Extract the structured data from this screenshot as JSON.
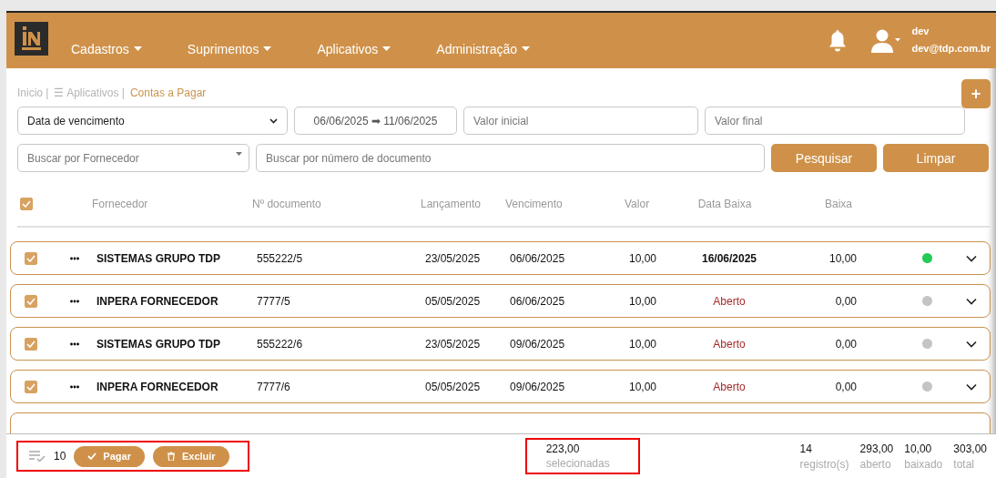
{
  "header": {
    "menus": [
      {
        "label": "Cadastros"
      },
      {
        "label": "Suprimentos"
      },
      {
        "label": "Aplicativos"
      },
      {
        "label": "Administração"
      }
    ],
    "user": {
      "name": "dev",
      "email": "dev@tdp.com.br"
    }
  },
  "breadcrumb": [
    {
      "label": "Inicio |",
      "current": false
    },
    {
      "label": "☰ Aplicativos |",
      "current": false
    },
    {
      "label": "Contas a Pagar",
      "current": true
    }
  ],
  "add_button": "+",
  "filters": {
    "date_type": "Data de vencimento",
    "date_range": "06/06/2025 ➡ 11/06/2025",
    "min_value": {
      "placeholder": "Valor inicial"
    },
    "max_value": {
      "placeholder": "Valor final"
    },
    "supplier": {
      "placeholder": "Buscar por Fornecedor"
    },
    "document": {
      "placeholder": "Buscar por número de documento"
    },
    "buttons": [
      "Pesquisar",
      "Limpar"
    ]
  },
  "table": {
    "all_checked": true,
    "columns": [
      "Fornecedor",
      "Nº documento",
      "Lançamento",
      "Vencimento",
      "Valor",
      "Data Baixa",
      "Baixa"
    ],
    "rows": [
      {
        "checked": true,
        "supplier": "SISTEMAS GRUPO TDP",
        "document": "555222/5",
        "issued": "23/05/2025",
        "due": "06/06/2025",
        "value": "10,00",
        "paid_date": "16/06/2025",
        "open": false,
        "paid": "10,00",
        "color": "#22cc55"
      },
      {
        "checked": true,
        "supplier": "INPERA FORNECEDOR",
        "document": "7777/5",
        "issued": "05/05/2025",
        "due": "06/06/2025",
        "value": "10,00",
        "paid_date": "Aberto",
        "open": true,
        "paid": "0,00",
        "color": "#c4c4c4"
      },
      {
        "checked": true,
        "supplier": "SISTEMAS GRUPO TDP",
        "document": "555222/6",
        "issued": "23/05/2025",
        "due": "09/06/2025",
        "value": "10,00",
        "paid_date": "Aberto",
        "open": true,
        "paid": "0,00",
        "color": "#c4c4c4"
      },
      {
        "checked": true,
        "supplier": "INPERA FORNECEDOR",
        "document": "7777/6",
        "issued": "05/05/2025",
        "due": "09/06/2025",
        "value": "10,00",
        "paid_date": "Aberto",
        "open": true,
        "paid": "0,00",
        "color": "#c4c4c4"
      }
    ]
  },
  "footer": {
    "selected_count": "10",
    "buttons": [
      "Pagar",
      "Excluir"
    ],
    "selected_total": {
      "value": "223,00",
      "label": "selecionadas"
    },
    "stats": [
      {
        "value": "14",
        "label": "registro(s)"
      },
      {
        "value": "293,00",
        "label": "aberto"
      },
      {
        "value": "10,00",
        "label": "baixado"
      },
      {
        "value": "303,00",
        "label": "total"
      }
    ]
  }
}
